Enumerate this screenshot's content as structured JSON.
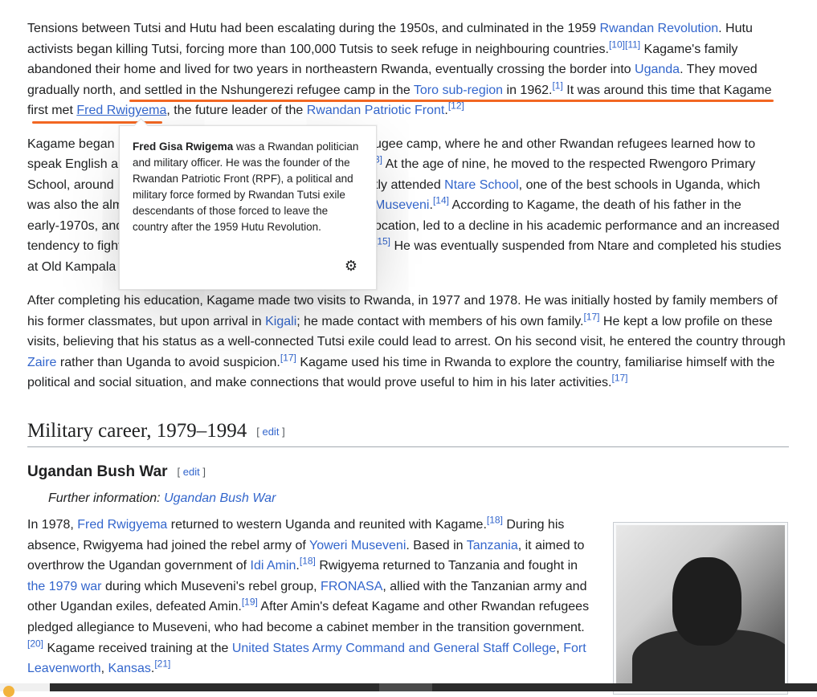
{
  "top_fragment": ",",
  "para1": {
    "t1": "Tensions between Tutsi and Hutu had been escalating during the 1950s, and culminated in the 1959 ",
    "link_rr": "Rwandan Revolution",
    "t2": ". Hutu activists began killing Tutsi, forcing more than 100,000 Tutsis to seek refuge in neighbouring countries.",
    "ref1": "[10]",
    "ref2": "[11]",
    "t3": " Kagame's family abandoned their home and lived for two years in northeastern Rwanda, eventually crossing the border into ",
    "link_uganda": "Uganda",
    "t4": ". They moved gradually north, and settled in the Nshungerezi refugee camp in the ",
    "link_toro": "Toro sub-region",
    "t5": " in 1962.",
    "ref3": "[1]",
    "t6": " It was around this time that Kagame first met ",
    "link_fred": "Fred Rwigyema",
    "t7": ", the future leader of the ",
    "link_rpf": "Rwandan Patriotic Front",
    "t8": ".",
    "ref4": "[12]"
  },
  "para2": {
    "l1a": "Kagame began",
    "l1b": "ugee camp, where he and other Rwandan refugees learned how to",
    "l2a": "speak English a",
    "l2ref": "3]",
    "l2b": " At the age of nine, he moved to the respected Rwengoro Primary",
    "l3a": "School, around",
    "l3b": "tly attended ",
    "l3link": "Ntare School",
    "l3c": ", one of the best schools in Uganda, which",
    "l4a": "was also the alm",
    "l4link": "Museveni",
    "l4b": ".",
    "l4ref": "[14]",
    "l4c": " According to Kagame, the death of his father in the",
    "l5a": "early-1970s, and",
    "l5b": "ocation, led to a decline in his academic performance and an increased",
    "l6a": "tendency to fight",
    "l6ref": "[15]",
    "l6b": " He was eventually suspended from Ntare and completed his studies",
    "l7a": "at Old Kampala"
  },
  "para3": {
    "t1": "After completing his education, Kagame made two visits to Rwanda, in 1977 and 1978. He was initially hosted by family members of his former classmates, but upon arrival in ",
    "link_kigali": "Kigali",
    "t2": "; he made contact with members of his own family.",
    "ref1": "[17]",
    "t3": " He kept a low profile on these visits, believing that his status as a well-connected Tutsi exile could lead to arrest. On his second visit, he entered the country through ",
    "link_zaire": "Zaire",
    "t4": " rather than Uganda to avoid suspicion.",
    "ref2": "[17]",
    "t5": " Kagame used his time in Rwanda to explore the country, familiarise himself with the political and social situation, and make connections that would prove useful to him in his later activities.",
    "ref3": "[17]"
  },
  "section": {
    "title": "Military career, 1979–1994",
    "edit_open": "[",
    "edit": "edit",
    "edit_close": "]"
  },
  "subsection": {
    "title": "Ugandan Bush War",
    "edit_open": "[",
    "edit": "edit",
    "edit_close": "]"
  },
  "hatnote": {
    "prefix": "Further information: ",
    "link": "Ugandan Bush War"
  },
  "para4": {
    "t1": "In 1978, ",
    "link_fred": "Fred Rwigyema",
    "t2": " returned to western Uganda and reunited with Kagame.",
    "ref1": "[18]",
    "t3": " During his absence, Rwigyema had joined the rebel army of ",
    "link_yoweri": "Yoweri Museveni",
    "t4": ". Based in ",
    "link_tanzania": "Tanzania",
    "t5": ", it aimed to overthrow the Ugandan government of ",
    "link_idi": "Idi Amin",
    "t6": ".",
    "ref2": "[18]",
    "t7": " Rwigyema returned to Tanzania and fought in ",
    "link_war": "the 1979 war",
    "t8": " during which Museveni's rebel group, ",
    "link_fronasa": "FRONASA",
    "t9": ", allied with the Tanzanian army and other Ugandan exiles, defeated Amin.",
    "ref3": "[19]",
    "t10": " After Amin's defeat Kagame and other Rwandan refugees pledged allegiance to Museveni, who had become a cabinet member in the transition government.",
    "ref4": "[20]",
    "t11": " Kagame received training at the ",
    "link_usa": "United States Army Command and General Staff College",
    "t12": ", ",
    "link_fort": "Fort Leavenworth",
    "t13": ", ",
    "link_kansas": "Kansas",
    "t14": ".",
    "ref5": "[21]"
  },
  "popup": {
    "name": "Fred Gisa Rwigema",
    "text": " was a Rwandan politician and military officer. He was the founder of the Rwandan Patriotic Front (RPF), a political and military force formed by Rwandan Tutsi exile descendants of those forced to leave the country after the 1959 Hutu Revolution.",
    "settings_icon": "gear-icon"
  },
  "colors": {
    "link": "#3366cc",
    "text": "#202122",
    "highlight": "#f26722"
  }
}
